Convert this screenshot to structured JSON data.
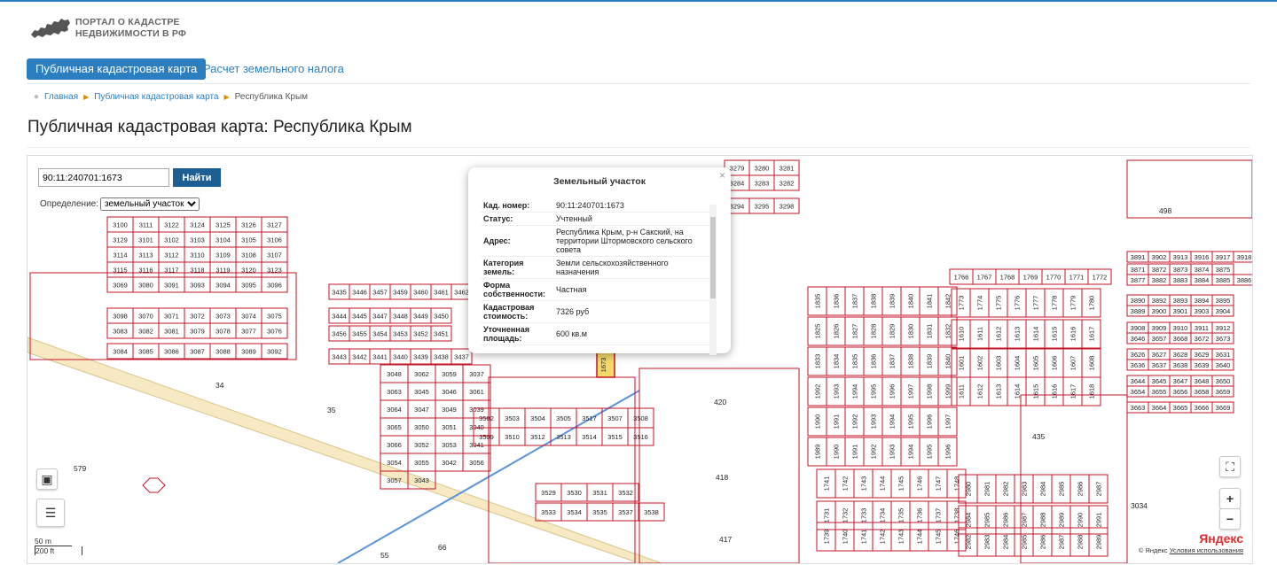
{
  "header": {
    "logo_line1": "ПОРТАЛ О КАДАСТРЕ",
    "logo_line2": "НЕДВИЖИМОСТИ В РФ"
  },
  "nav": {
    "tab_map": "Публичная кадастровая карта",
    "tab_tax": "Расчет земельного налога"
  },
  "breadcrumb": {
    "home": "Главная",
    "map": "Публичная кадастровая карта",
    "current": "Республика Крым"
  },
  "page_title": "Публичная кадастровая карта: Республика Крым",
  "map": {
    "search_value": "90:11:240701:1673",
    "search_button": "Найти",
    "definition_label": "Определение:",
    "definition_value": "земельный участок",
    "scale_m": "50 m",
    "scale_ft": "200 ft",
    "yandex": "Яндекс",
    "copyright_prefix": "© Яндекс",
    "terms": "Условия использования",
    "parcel_labels": [
      "34",
      "35",
      "579",
      "66",
      "55",
      "420",
      "418",
      "417",
      "435",
      "498",
      "3034",
      "1673"
    ],
    "parcel_row_a": [
      "3100",
      "3111",
      "3122",
      "3124",
      "3125",
      "3126",
      "3127"
    ],
    "parcel_row_b": [
      "3129",
      "3101",
      "3102",
      "3103",
      "3104",
      "3105",
      "3106"
    ],
    "parcel_row_c": [
      "3114",
      "3113",
      "3112",
      "3110",
      "3109",
      "3108",
      "3107"
    ],
    "parcel_row_d": [
      "3115",
      "3116",
      "3117",
      "3118",
      "3119",
      "3120",
      "3123"
    ],
    "parcel_row_e": [
      "3069",
      "3080",
      "3091",
      "3093",
      "3094",
      "3095",
      "3096"
    ],
    "parcel_row_f": [
      "3098",
      "3070",
      "3071",
      "3072",
      "3073",
      "3074",
      "3075"
    ],
    "parcel_row_g": [
      "3083",
      "3082",
      "3081",
      "3079",
      "3078",
      "3077",
      "3076"
    ],
    "parcel_row_h": [
      "3084",
      "3085",
      "3086",
      "3087",
      "3088",
      "3089",
      "3092"
    ],
    "parcel_row_i": [
      "3435",
      "3446",
      "3457",
      "3459",
      "3460",
      "3461",
      "3462"
    ],
    "parcel_row_j": [
      "3444",
      "3445",
      "3447",
      "3448",
      "3449",
      "3450"
    ],
    "parcel_row_k": [
      "3456",
      "3455",
      "3454",
      "3453",
      "3452",
      "3451"
    ],
    "parcel_row_l": [
      "3443",
      "3442",
      "3441",
      "3440",
      "3439",
      "3438",
      "3437"
    ],
    "parcel_row_m": [
      "3502",
      "3503",
      "3504",
      "3505",
      "3517",
      "3507",
      "3508"
    ],
    "parcel_row_n": [
      "3509",
      "3510",
      "3512",
      "3513",
      "3514",
      "3515",
      "3516"
    ],
    "parcel_row_o": [
      "3529",
      "3530",
      "3531",
      "3532"
    ],
    "parcel_row_p": [
      "3533",
      "3534",
      "3535",
      "3537",
      "3538"
    ],
    "parcel_row_q": [
      "3279",
      "3280",
      "3281",
      "3284",
      "3283",
      "3282",
      "3294",
      "3295",
      "3298"
    ],
    "parcel_row_r": [
      "1766",
      "1767",
      "1768",
      "1769",
      "1770",
      "1771",
      "1772"
    ],
    "parcel_row_s": [
      "3891",
      "3902",
      "3913",
      "3916",
      "3917",
      "3918",
      "3871",
      "3872",
      "3873",
      "3874",
      "3875",
      "3877",
      "3882",
      "3883",
      "3884",
      "3885",
      "3886"
    ],
    "parcel_row_t": [
      "3890",
      "3892",
      "3893",
      "3894",
      "3895",
      "3889",
      "3900",
      "3901",
      "3903",
      "3904"
    ],
    "parcel_row_u": [
      "3908",
      "3909",
      "3910",
      "3911",
      "3912",
      "3646",
      "3657",
      "3668",
      "3672",
      "3673"
    ],
    "parcel_row_v": [
      "3626",
      "3627",
      "3628",
      "3629",
      "3631",
      "3636",
      "3637",
      "3638",
      "3639",
      "3640"
    ],
    "parcel_row_w": [
      "3644",
      "3645",
      "3647",
      "3648",
      "3650",
      "3654",
      "3655",
      "3656",
      "3658",
      "3659"
    ],
    "parcel_row_x": [
      "3663",
      "3664",
      "3665",
      "3666",
      "3669"
    ],
    "parcel_row_y": [
      "3048",
      "3062",
      "3059",
      "3037",
      "3063",
      "3045",
      "3046",
      "3061",
      "3064",
      "3047",
      "3049",
      "3039",
      "3065",
      "3050",
      "3051",
      "3040",
      "3066",
      "3052",
      "3053",
      "3041",
      "3054",
      "3055",
      "3042",
      "3056",
      "3057",
      "3043"
    ],
    "parcel_row_z": [
      "2981",
      "3034"
    ]
  },
  "popup": {
    "title": "Земельный участок",
    "rows": [
      {
        "k": "Кад. номер:",
        "v": "90:11:240701:1673"
      },
      {
        "k": "Статус:",
        "v": "Учтенный"
      },
      {
        "k": "Адрес:",
        "v": "Республика Крым, р-н Сакский, на территории Штормовского сельского совета"
      },
      {
        "k": "Категория земель:",
        "v": "Земли сельскохозяйственного назначения"
      },
      {
        "k": "Форма собственности:",
        "v": "Частная"
      },
      {
        "k": "Кадастровая стоимость:",
        "v": "7326 руб"
      },
      {
        "k": "Уточненная площадь:",
        "v": "600 кв.м"
      }
    ]
  },
  "colors": {
    "accent": "#2b7fc0",
    "parcel_line": "#c4142a",
    "road_fill": "#f6e9c4",
    "button_dark": "#1e5f93"
  }
}
